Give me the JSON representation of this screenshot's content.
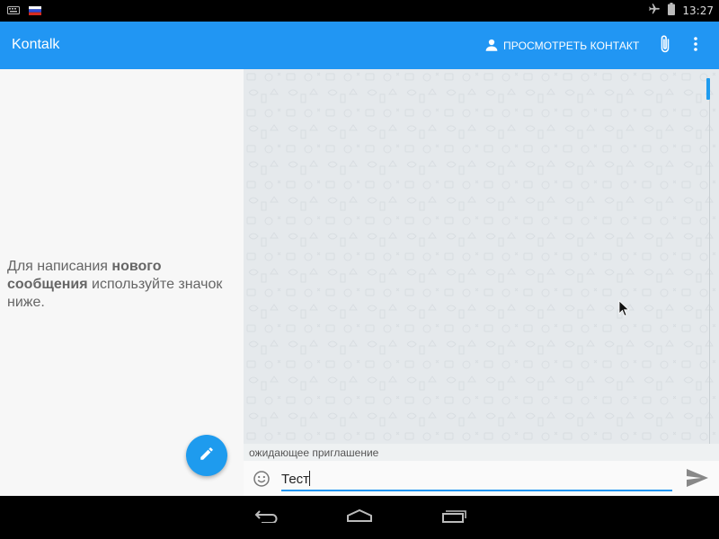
{
  "status_bar": {
    "time": "13:27",
    "icons": [
      "keyboard-icon",
      "flag-ru-icon",
      "airplane-icon",
      "battery-icon"
    ]
  },
  "app_bar": {
    "title": "Kontalk",
    "view_contact_label": "ПРОСМОТРЕТЬ КОНТАКТ",
    "icons": [
      "person-icon",
      "attach-icon",
      "overflow-menu-icon"
    ]
  },
  "left_pane": {
    "hint_part1": "Для написания ",
    "hint_bold": "нового сообщения",
    "hint_part2": " используйте значок ниже.",
    "fab_icon": "pencil-icon"
  },
  "chat": {
    "status_text": "ожидающее приглашение",
    "input_value": "Тест",
    "emoji_icon": "emoji-icon",
    "send_icon": "send-icon"
  },
  "nav_bar": {
    "icons": [
      "back-icon",
      "home-icon",
      "recents-icon"
    ]
  },
  "colors": {
    "app_bar": "#2196f3",
    "fab": "#1e9bee",
    "left_pane_bg": "#f7f7f7",
    "chat_bg": "#e5e9ec"
  }
}
